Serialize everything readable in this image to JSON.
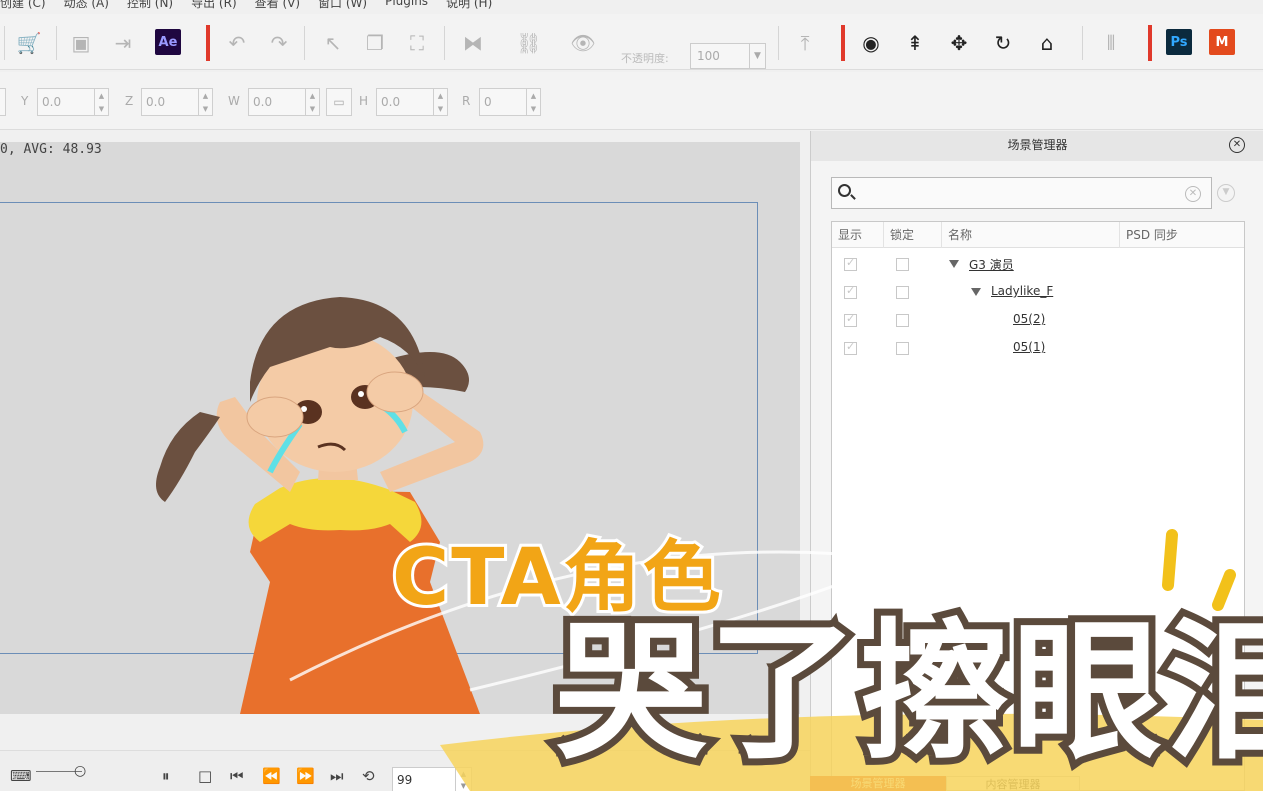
{
  "menu": [
    "创建 (C)",
    "动态 (A)",
    "控制 (N)",
    "导出 (R)",
    "查看 (V)",
    "窗口 (W)",
    "Plugins",
    "说明 (H)"
  ],
  "toolbar": {
    "ae_label": "Ae",
    "ps_label": "Ps",
    "opacity_label": "不透明度:",
    "opacity_value": "100",
    "accent_red": "#e0392b"
  },
  "coords": {
    "y_label": "Y",
    "y_value": "0.0",
    "z_label": "Z",
    "z_value": "0.0",
    "w_label": "W",
    "w_value": "0.0",
    "h_label": "H",
    "h_value": "0.0",
    "r_label": "R",
    "r_value": "0"
  },
  "stage": {
    "fps_text": "0, AVG: 48.93"
  },
  "playbar": {
    "frame_value": "99"
  },
  "scene_manager": {
    "title": "场景管理器",
    "search_value": "",
    "columns": [
      "显示",
      "锁定",
      "名称",
      "PSD 同步"
    ],
    "rows": [
      {
        "name": "G3 演员",
        "visible": true,
        "locked": false
      },
      {
        "name": "Ladylike_F",
        "visible": true,
        "locked": false
      },
      {
        "name": "05(2)",
        "visible": true,
        "locked": false
      },
      {
        "name": "05(1)",
        "visible": true,
        "locked": false
      }
    ],
    "tabs": [
      "场景管理器",
      "内容管理器"
    ]
  },
  "captions": {
    "line1": "CTA角色",
    "line2": "哭了擦眼泪",
    "line1_color": "#f2a516"
  }
}
